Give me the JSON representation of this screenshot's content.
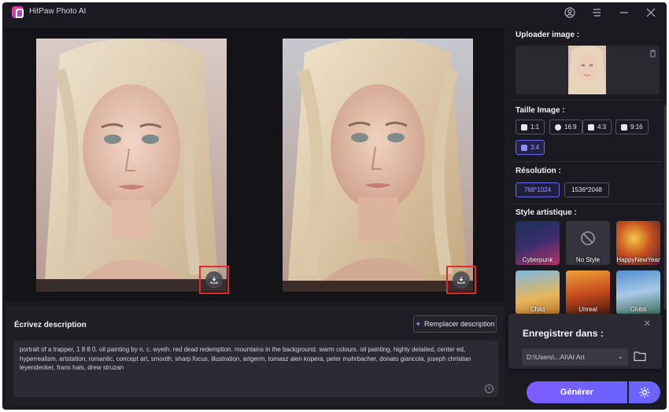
{
  "app": {
    "title": "HitPaw Photo AI"
  },
  "description": {
    "heading": "Écrivez description",
    "replace_label": "Remplacer description",
    "text": "portrait of a trapper, 1 8 8 0. oil painting by n. c. wyeth. red dead redemption. mountains in the background. warm colours. oil painting, highly detailed, center ed, hyperrealism, artstation, romantic, concept art, smooth, sharp focus, illustration, artgerm, tomasz alen kopera, peter mohrbacher, donato giancola, joseph christian leyendecker, frans hals, drew struzan"
  },
  "sidebar": {
    "upload_label": "Uploader image :",
    "size_label": "Taille Image :",
    "sizes": [
      {
        "label": "1:1",
        "icon": "instagram-icon"
      },
      {
        "label": "16:9",
        "icon": "facebook-icon"
      },
      {
        "label": "4:3",
        "icon": "twitter-icon"
      },
      {
        "label": "9:16",
        "icon": "instagram-icon"
      },
      {
        "label": "3:4",
        "icon": "twitter-icon",
        "active": true
      }
    ],
    "resolution_label": "Résolution :",
    "resolutions": [
      {
        "label": "768*1024",
        "active": true
      },
      {
        "label": "1536*2048"
      }
    ],
    "style_label": "Style artistique :",
    "styles": [
      {
        "label": "Cyberpunk"
      },
      {
        "label": "No Style"
      },
      {
        "label": "HappyNewYear"
      },
      {
        "label": "Child"
      },
      {
        "label": "Unreal"
      },
      {
        "label": "Ghibli"
      }
    ]
  },
  "save": {
    "title": "Enregistrer dans :",
    "path": "D:\\Users\\...AI\\AI Art"
  },
  "generate_label": "Générer",
  "colors": {
    "accent": "#6b63ff",
    "highlight": "#e12a2a",
    "background": "#1b1a21"
  }
}
